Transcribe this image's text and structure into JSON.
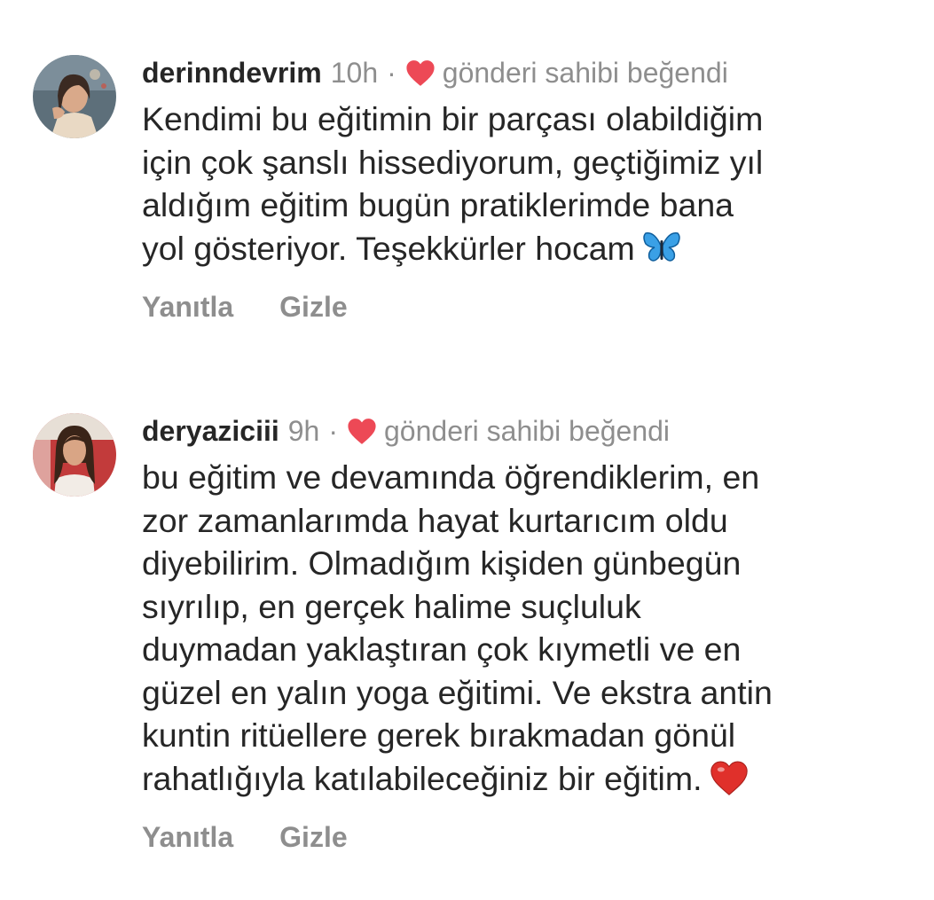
{
  "comments": [
    {
      "username": "derinndevrim",
      "time": "10h",
      "separator": "·",
      "liked_by_author": "gönderi sahibi beğendi",
      "text_lines": [
        "Kendimi bu eğitimin bir parçası olabildiğim",
        "için çok şanslı hissediyorum, geçtiğimiz yıl",
        "aldığım eğitim bugün pratiklerimde bana",
        "yol gösteriyor. Teşekkürler hocam"
      ],
      "emoji": "butterfly-emoji",
      "reply_label": "Yanıtla",
      "hide_label": "Gizle"
    },
    {
      "username": "deryaziciii",
      "time": "9h",
      "separator": "·",
      "liked_by_author": "gönderi sahibi beğendi",
      "text_lines": [
        "bu eğitim ve devamında öğrendiklerim, en",
        "zor zamanlarımda hayat kurtarıcım oldu",
        "diyebilirim. Olmadığım kişiden günbegün",
        "sıyrılıp, en gerçek halime suçluluk",
        "duymadan yaklaştıran çok kıymetli ve en",
        "güzel en yalın yoga eğitimi. Ve ekstra antin",
        "kuntin ritüellere gerek bırakmadan gönül",
        "rahatlığıyla katılabileceğiniz bir eğitim."
      ],
      "emoji": "red-heart-emoji",
      "reply_label": "Yanıtla",
      "hide_label": "Gizle"
    }
  ],
  "colors": {
    "primary_text": "#262626",
    "secondary_text": "#8e8e8e",
    "heart_red": "#ed4956",
    "butterfly_blue": "#3aa0e6"
  }
}
